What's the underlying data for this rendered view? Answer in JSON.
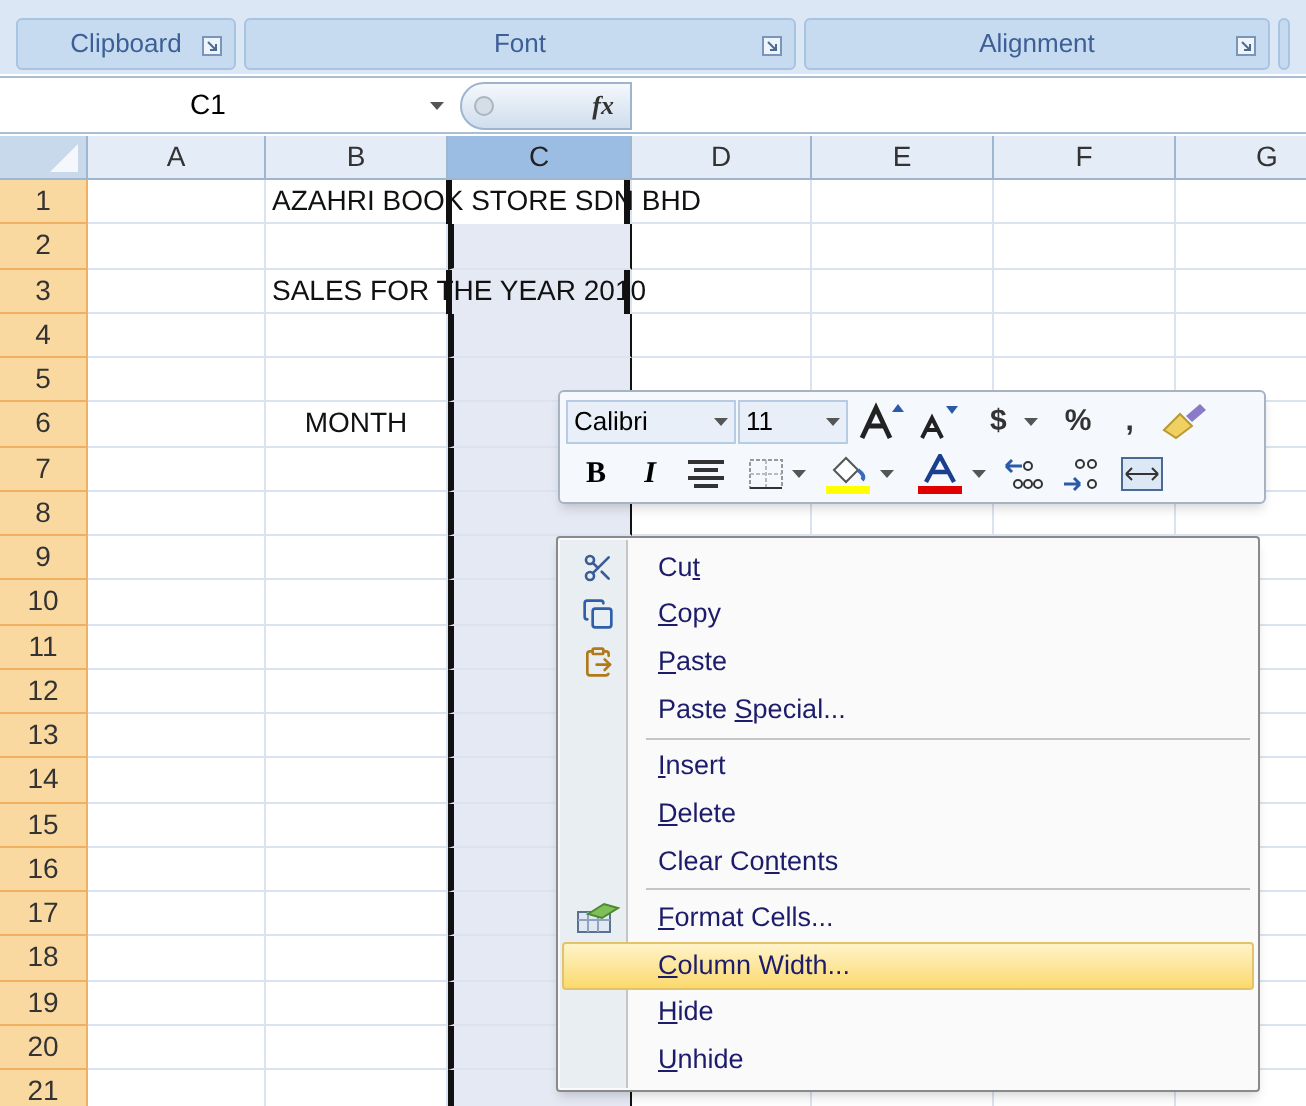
{
  "ribbon_groups": [
    {
      "label": "Clipboard"
    },
    {
      "label": "Font"
    },
    {
      "label": "Alignment"
    }
  ],
  "formula_bar": {
    "name_box": "C1",
    "fx": "fx"
  },
  "columns": [
    {
      "label": "A",
      "selected": false
    },
    {
      "label": "B",
      "selected": false
    },
    {
      "label": "C",
      "selected": true
    },
    {
      "label": "D",
      "selected": false
    },
    {
      "label": "E",
      "selected": false
    },
    {
      "label": "F",
      "selected": false
    },
    {
      "label": "G",
      "selected": false
    }
  ],
  "rows": [
    {
      "number": "1",
      "column_b": "AZAHRI BOOK STORE SDN BHD"
    },
    {
      "number": "2"
    },
    {
      "number": "3",
      "column_b": "SALES FOR THE YEAR 2010"
    },
    {
      "number": "4"
    },
    {
      "number": "5"
    },
    {
      "number": "6",
      "column_b": "MONTH",
      "centered": true
    },
    {
      "number": "7"
    },
    {
      "number": "8"
    },
    {
      "number": "9"
    },
    {
      "number": "10"
    },
    {
      "number": "11"
    },
    {
      "number": "12"
    },
    {
      "number": "13"
    },
    {
      "number": "14"
    },
    {
      "number": "15"
    },
    {
      "number": "16"
    },
    {
      "number": "17"
    },
    {
      "number": "18"
    },
    {
      "number": "19"
    },
    {
      "number": "20"
    },
    {
      "number": "21"
    }
  ],
  "mini_toolbar": {
    "font": "Calibri",
    "size": "11",
    "row1_glyphs": [
      "$",
      "%",
      ","
    ],
    "bold": "B",
    "italic": "I"
  },
  "context_menu": [
    {
      "kind": "item",
      "pre": "Cu",
      "key": "t",
      "selected": false
    },
    {
      "kind": "item",
      "key": "C",
      "post": "opy",
      "selected": false
    },
    {
      "kind": "item",
      "key": "P",
      "post": "aste",
      "selected": false
    },
    {
      "kind": "item",
      "pre": "Paste ",
      "key": "S",
      "post": "pecial...",
      "selected": false
    },
    {
      "kind": "separator"
    },
    {
      "kind": "item",
      "key": "I",
      "post": "nsert",
      "selected": false
    },
    {
      "kind": "item",
      "key": "D",
      "post": "elete",
      "selected": false
    },
    {
      "kind": "item",
      "pre": "Clear Co",
      "key": "n",
      "post": "tents",
      "selected": false
    },
    {
      "kind": "separator"
    },
    {
      "kind": "item",
      "key": "F",
      "post": "ormat Cells...",
      "selected": false
    },
    {
      "kind": "item",
      "key": "C",
      "post": "olumn Width...",
      "selected": true
    },
    {
      "kind": "item",
      "key": "H",
      "post": "ide",
      "selected": false
    },
    {
      "kind": "item",
      "key": "U",
      "post": "nhide",
      "selected": false
    }
  ]
}
